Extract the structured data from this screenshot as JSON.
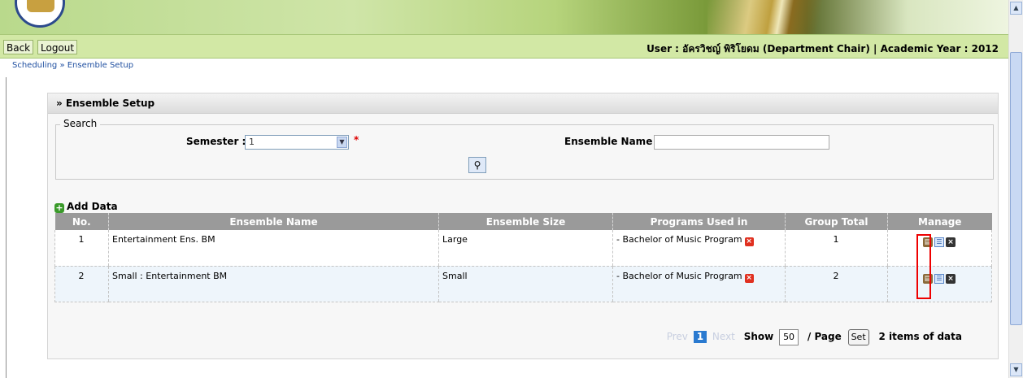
{
  "nav": {
    "back": "Back",
    "logout": "Logout",
    "user_info": "User : อัครวิชญ์ พิริโยดม (Department Chair) | Academic Year : 2012"
  },
  "breadcrumb": "Scheduling » Ensemble Setup",
  "panel_title": "» Ensemble Setup",
  "search": {
    "legend": "Search",
    "semester_label": "Semester :",
    "semester_value": "1",
    "required_mark": "*",
    "ensemble_name_label": "Ensemble Name :",
    "ensemble_name_value": ""
  },
  "add_data": "Add Data",
  "table": {
    "headers": [
      "No.",
      "Ensemble Name",
      "Ensemble Size",
      "Programs Used in",
      "Group Total",
      "Manage"
    ],
    "rows": [
      {
        "no": "1",
        "name": "Entertainment Ens. BM",
        "size": "Large",
        "program": "- Bachelor of Music Program",
        "total": "1"
      },
      {
        "no": "2",
        "name": "Small : Entertainment BM",
        "size": "Small",
        "program": "- Bachelor of Music Program",
        "total": "2"
      }
    ]
  },
  "pager": {
    "prev": "Prev",
    "page": "1",
    "next": "Next",
    "show_label": "Show",
    "per_page": "50",
    "page_label": "/ Page",
    "set": "Set",
    "items": "2 items of data"
  },
  "icons": [
    "book-icon",
    "tree-icon",
    "delete-icon",
    "remove-program-icon",
    "search-icon",
    "add-icon"
  ],
  "colors": {
    "nav_bg": "#d2e8a5",
    "header_bg": "#9a9a9a",
    "highlight": "#e00000",
    "alt_row": "#eef5fb"
  }
}
